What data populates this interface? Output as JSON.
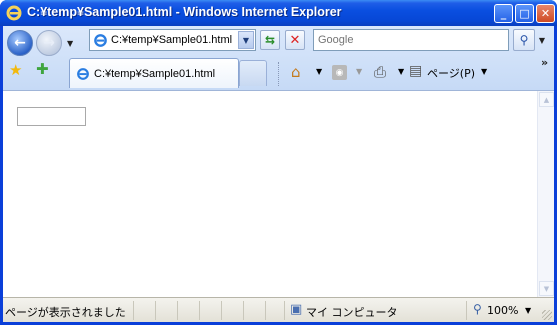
{
  "window": {
    "title": "C:¥temp¥Sample01.html - Windows Internet Explorer"
  },
  "titlebar_buttons": {
    "minimize": "_",
    "maximize": "□",
    "close": "✕"
  },
  "navigation": {
    "address": "C:¥temp¥Sample01.html",
    "search_placeholder": "Google"
  },
  "tabs": [
    {
      "label": "C:¥temp¥Sample01.html"
    }
  ],
  "command_bar": {
    "page_label": "ページ(P)"
  },
  "status_bar": {
    "message": "ページが表示されました",
    "zone": "マイ コンピュータ",
    "zoom": "100%"
  }
}
